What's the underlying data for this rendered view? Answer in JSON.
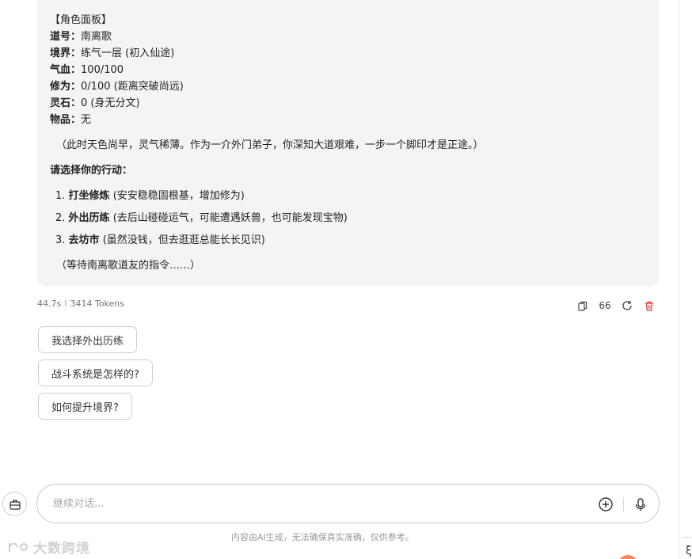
{
  "panel": {
    "header": "【角色面板】",
    "stats": [
      {
        "label": "道号",
        "value": "南离歌"
      },
      {
        "label": "境界",
        "value": "练气一层 (初入仙途)"
      },
      {
        "label": "气血",
        "value": "100/100"
      },
      {
        "label": "修为",
        "value": "0/100 (距离突破尚远)"
      },
      {
        "label": "灵石",
        "value": "0 (身无分文)"
      },
      {
        "label": "物品",
        "value": "无"
      }
    ],
    "colon": "：",
    "narration": "（此时天色尚早，灵气稀薄。作为一介外门弟子，你深知大道艰难，一步一个脚印才是正途。）",
    "prompt": "请选择你的行动：",
    "options": [
      {
        "num": "1.",
        "title": "打坐修炼",
        "desc": "(安安稳稳固根基，增加修为)"
      },
      {
        "num": "2.",
        "title": "外出历练",
        "desc": "(去后山碰碰运气，可能遭遇妖兽，也可能发现宝物)"
      },
      {
        "num": "3.",
        "title": "去坊市",
        "desc": "(虽然没钱，但去逛逛总能长长见识)"
      }
    ],
    "waiting": "（等待南离歌道友的指令……）"
  },
  "meta": {
    "time": "44.7s",
    "separator": "I",
    "tokens": "3414 Tokens"
  },
  "toolbar": {
    "quote_label": "66"
  },
  "suggestions": [
    "我选择外出历练",
    "战斗系统是怎样的?",
    "如何提升境界?"
  ],
  "input": {
    "placeholder": "继续对话..."
  },
  "disclaimer": "内容由AI生成，无法确保真实准确，仅供参考。",
  "watermark": {
    "text": "大数跨境"
  },
  "right_edge_glyph": "ξ",
  "colors": {
    "panel_bg": "#f4f4f5",
    "delete_red": "#e23b3b",
    "corner_orange": "#f08a5d"
  }
}
